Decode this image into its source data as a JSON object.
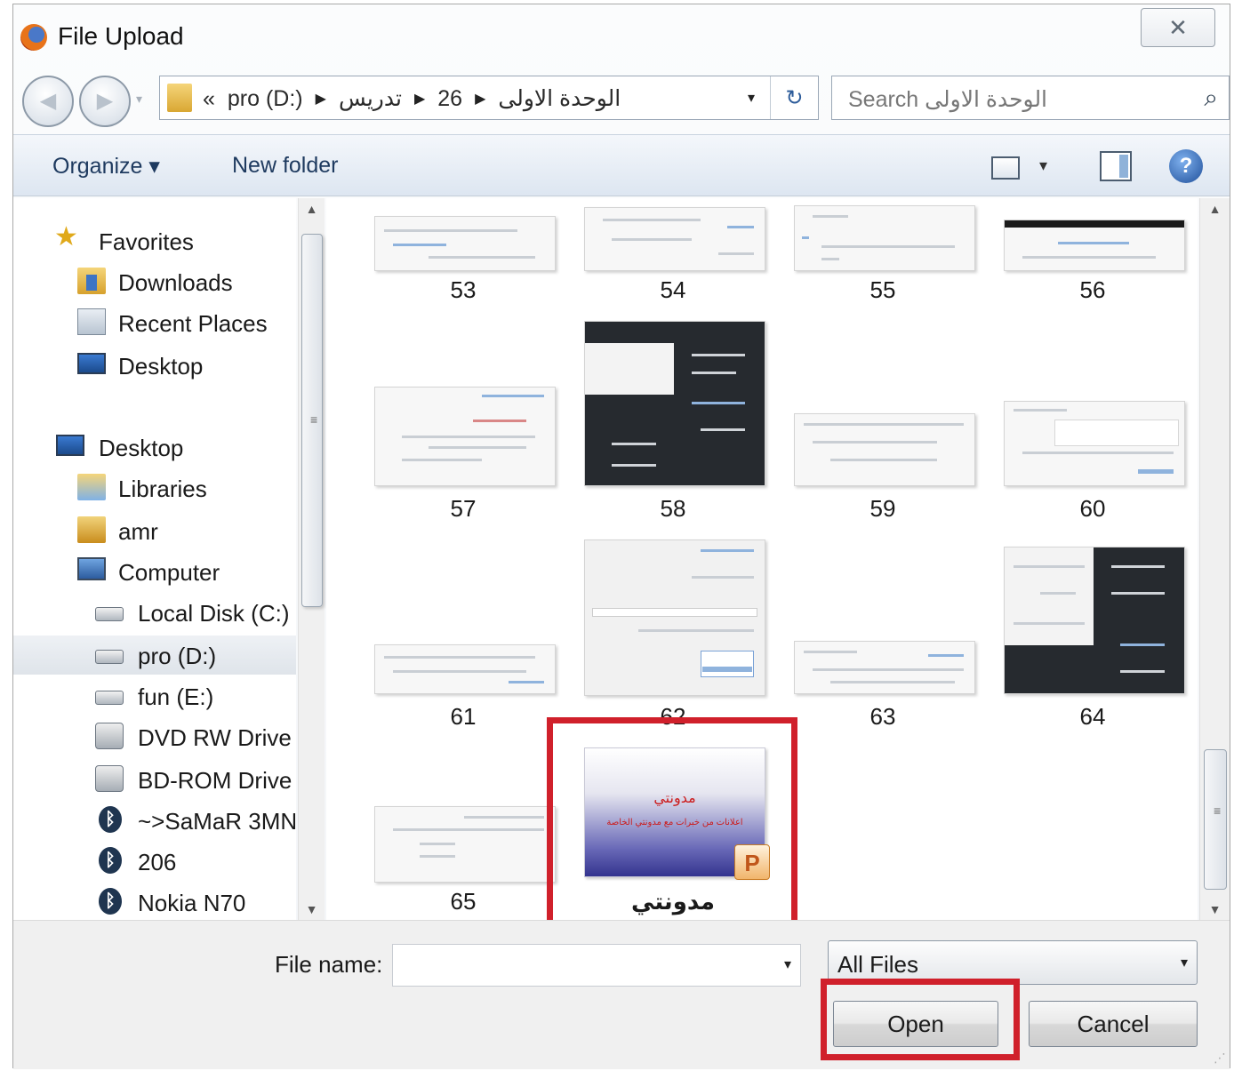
{
  "window": {
    "title": "File Upload",
    "close_glyph": "✕",
    "app_icon": "firefox-icon"
  },
  "address": {
    "back_glyph": "◀",
    "forward_glyph": "▶",
    "history_glyph": "▾",
    "overflow": "«",
    "crumbs": [
      "pro (D:)",
      "تدريس",
      "26",
      "الوحدة الاولى"
    ],
    "sep_glyph": "▶",
    "drop_glyph": "▾",
    "refresh_glyph": "↻"
  },
  "search": {
    "placeholder": "Search الوحدة الاولى",
    "icon_glyph": "⌕"
  },
  "toolbar": {
    "organize_label": "Organize ▾",
    "new_folder_label": "New folder",
    "view_drop_glyph": "▾",
    "help_glyph": "?"
  },
  "nav": {
    "items": [
      {
        "label": "Favorites",
        "icon": "star-icon"
      },
      {
        "label": "Downloads",
        "icon": "downloads-icon"
      },
      {
        "label": "Recent Places",
        "icon": "recent-places-icon"
      },
      {
        "label": "Desktop",
        "icon": "desktop-icon"
      },
      {
        "label": "Desktop",
        "icon": "desktop-icon"
      },
      {
        "label": "Libraries",
        "icon": "libraries-icon"
      },
      {
        "label": "amr",
        "icon": "user-folder-icon"
      },
      {
        "label": "Computer",
        "icon": "computer-icon"
      },
      {
        "label": "Local Disk (C:)",
        "icon": "local-disk-icon"
      },
      {
        "label": "pro (D:)",
        "icon": "drive-icon",
        "selected": true
      },
      {
        "label": "fun (E:)",
        "icon": "drive-icon"
      },
      {
        "label": "DVD RW Drive (",
        "icon": "dvd-drive-icon"
      },
      {
        "label": "BD-ROM Drive",
        "icon": "bd-drive-icon"
      },
      {
        "label": "~>SaMaR 3MN",
        "icon": "bluetooth-icon"
      },
      {
        "label": "206",
        "icon": "bluetooth-icon"
      },
      {
        "label": "Nokia N70",
        "icon": "bluetooth-icon"
      }
    ],
    "bt_glyph": "ᛒ",
    "grip_glyph": "≡",
    "up_glyph": "▲",
    "down_glyph": "▼"
  },
  "files": [
    {
      "name": "53"
    },
    {
      "name": "54"
    },
    {
      "name": "55"
    },
    {
      "name": "56"
    },
    {
      "name": "57"
    },
    {
      "name": "58"
    },
    {
      "name": "59"
    },
    {
      "name": "60"
    },
    {
      "name": "61"
    },
    {
      "name": "62"
    },
    {
      "name": "63"
    },
    {
      "name": "64"
    },
    {
      "name": "65"
    },
    {
      "name": "مدونتي",
      "type": "powerpoint"
    }
  ],
  "ppt_preview": {
    "title": "مدونتي",
    "subtitle": "اعلانات من خبرات مع مدونتي الخاصة",
    "badge": "P"
  },
  "bottom": {
    "file_name_label": "File name:",
    "file_name_value": "",
    "drop_glyph": "▾",
    "filter_value": "All Files",
    "open_label": "Open",
    "cancel_label": "Cancel",
    "resize_glyph": "⋰"
  },
  "colors": {
    "highlight": "#d0202b",
    "toolbar_text": "#1e3a5f"
  }
}
